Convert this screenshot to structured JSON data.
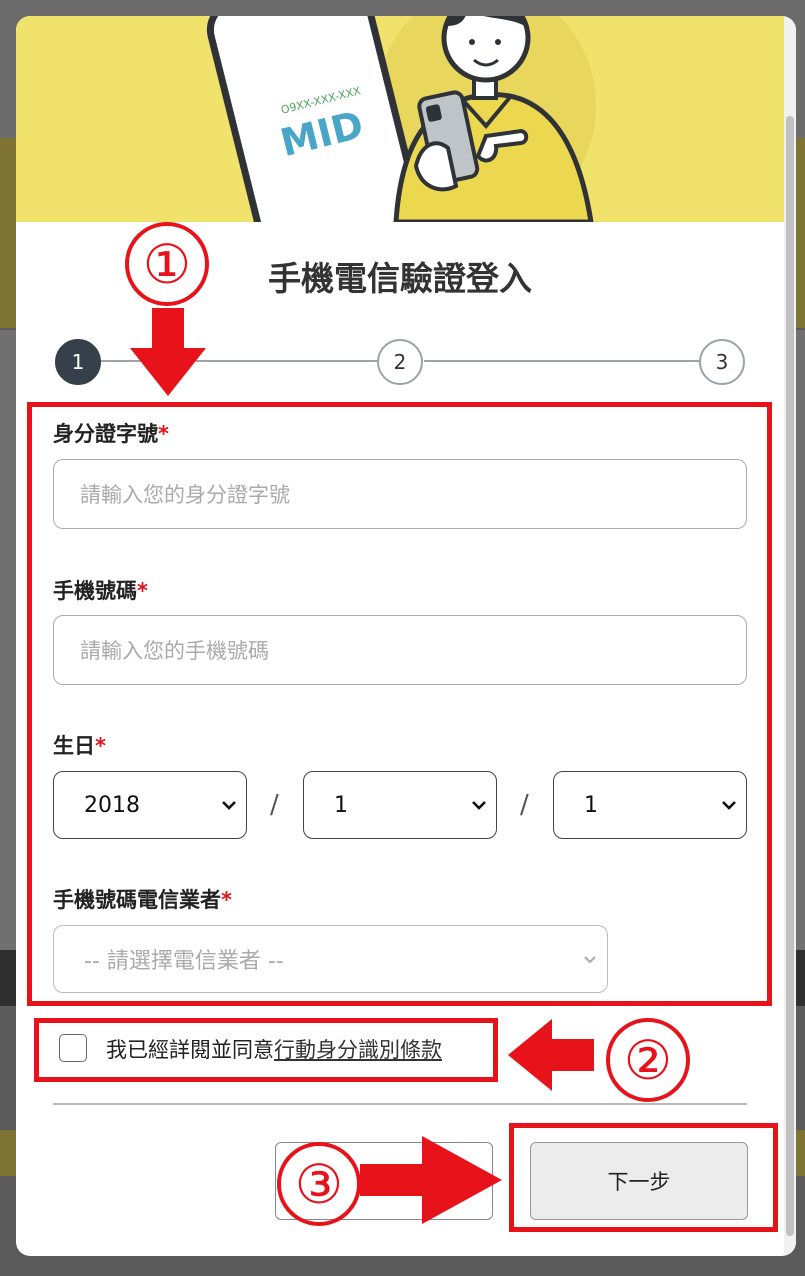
{
  "modal": {
    "banner_logo_small": "O9XX-XXX-XXX",
    "banner_logo": "MID",
    "title": "手機電信驗證登入",
    "steps": [
      "1",
      "2",
      "3"
    ],
    "fields": {
      "id_label": "身分證字號",
      "id_placeholder": "請輸入您的身分證字號",
      "phone_label": "手機號碼",
      "phone_placeholder": "請輸入您的手機號碼",
      "birthday_label": "生日",
      "birthday_year": "2018",
      "birthday_month": "1",
      "birthday_day": "1",
      "date_separator": "/",
      "carrier_label": "手機號碼電信業者",
      "carrier_placeholder": "-- 請選擇電信業者 --",
      "required_mark": "*"
    },
    "agree_text": "我已經詳閱並同意",
    "agree_link": "行動身分識別條款",
    "next_button": "下一步"
  },
  "annotations": {
    "circle_1": "①",
    "circle_2": "②",
    "circle_3": "③"
  },
  "colors": {
    "banner": "#f1e26c",
    "annotation_red": "#e8121a",
    "step_active": "#36404a"
  }
}
